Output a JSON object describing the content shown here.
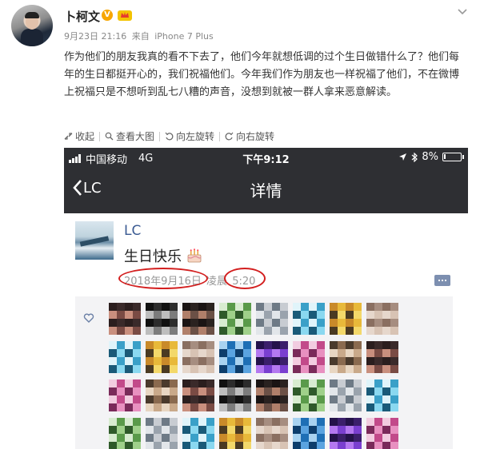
{
  "post": {
    "username": "卜柯文",
    "verified_badge": "V",
    "date": "9月23日 21:16",
    "source_prefix": "来自",
    "device": "iPhone 7 Plus",
    "content": "作为他们的朋友我真的看不下去了，他们今年就想低调的过个生日做错什么了？他们每年的生日都挺开心的，我们祝福他们。今年我们作为朋友也一样祝福了他们，不在微博上祝福只是不想听到乱七八糟的声音，没想到就被一群人拿来恶意解读。"
  },
  "toolbar": {
    "collapse": "收起",
    "view_large": "查看大图",
    "rotate_left": "向左旋转",
    "rotate_right": "向右旋转"
  },
  "screenshot": {
    "carrier": "中国移动",
    "network": "4G",
    "time": "下午9:12",
    "battery": "8%",
    "back_label": "LC",
    "title": "详情",
    "moment": {
      "name": "LC",
      "text": "生日快乐",
      "date": "2018年9月16日",
      "period": "凌晨",
      "clock": "5:20"
    }
  },
  "colors": {
    "dark_bar": "#2e2f33",
    "link_blue": "#3b5b93",
    "circle_red": "#d31f1f"
  },
  "icons": [
    "chevron-down-icon",
    "crown-icon",
    "collapse-icon",
    "magnifier-icon",
    "rotate-left-icon",
    "rotate-right-icon",
    "signal-icon",
    "location-icon",
    "bluetooth-icon",
    "battery-icon",
    "back-arrow-icon",
    "cake-icon",
    "comment-icon",
    "heart-icon"
  ]
}
